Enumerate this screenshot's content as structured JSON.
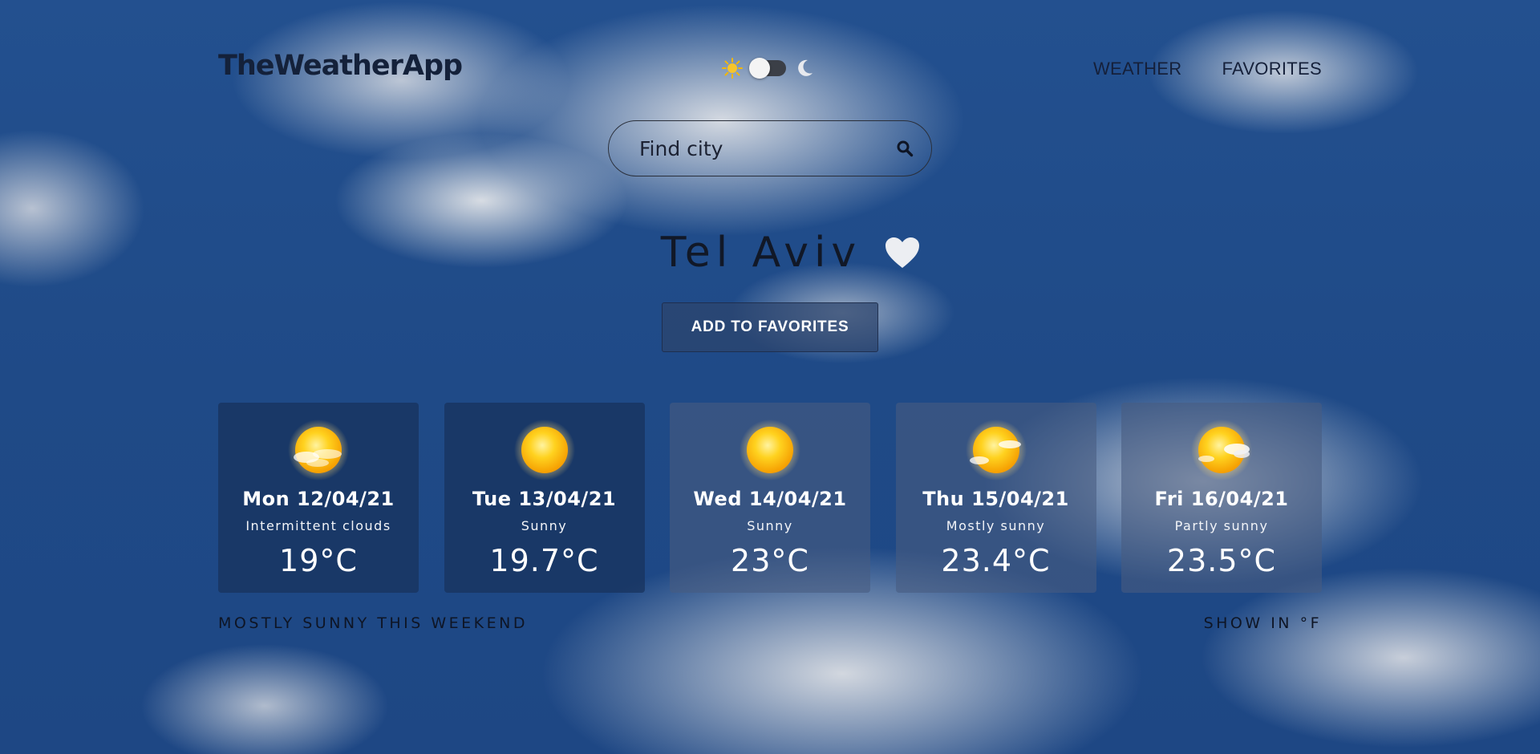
{
  "header": {
    "logo": "TheWeatherApp",
    "theme": {
      "mode": "light",
      "light_icon": "sun-icon",
      "dark_icon": "moon-icon"
    },
    "nav": [
      {
        "label": "WEATHER"
      },
      {
        "label": "FAVORITES"
      }
    ]
  },
  "search": {
    "placeholder": "Find city",
    "value": "",
    "icon": "search-icon"
  },
  "city": {
    "name": "Tel Aviv",
    "favorite_icon": "heart-icon",
    "add_to_favorites_label": "ADD TO FAVORITES"
  },
  "forecast": [
    {
      "date": "Mon 12/04/21",
      "description": "Intermittent clouds",
      "temp": "19°C",
      "icon": "sun-behind-clouds-icon"
    },
    {
      "date": "Tue 13/04/21",
      "description": "Sunny",
      "temp": "19.7°C",
      "icon": "sun-icon"
    },
    {
      "date": "Wed 14/04/21",
      "description": "Sunny",
      "temp": "23°C",
      "icon": "sun-icon"
    },
    {
      "date": "Thu 15/04/21",
      "description": "Mostly sunny",
      "temp": "23.4°C",
      "icon": "sun-small-cloud-icon"
    },
    {
      "date": "Fri 16/04/21",
      "description": "Partly sunny",
      "temp": "23.5°C",
      "icon": "sun-with-cloud-icon"
    }
  ],
  "summary": "MOSTLY SUNNY THIS WEEKEND",
  "unit_toggle": "SHOW IN °F",
  "colors": {
    "sky": "#1f4a87",
    "card": "#18325c",
    "button": "#2d446c",
    "text_dark": "#111827",
    "sun": "#ffb800"
  }
}
